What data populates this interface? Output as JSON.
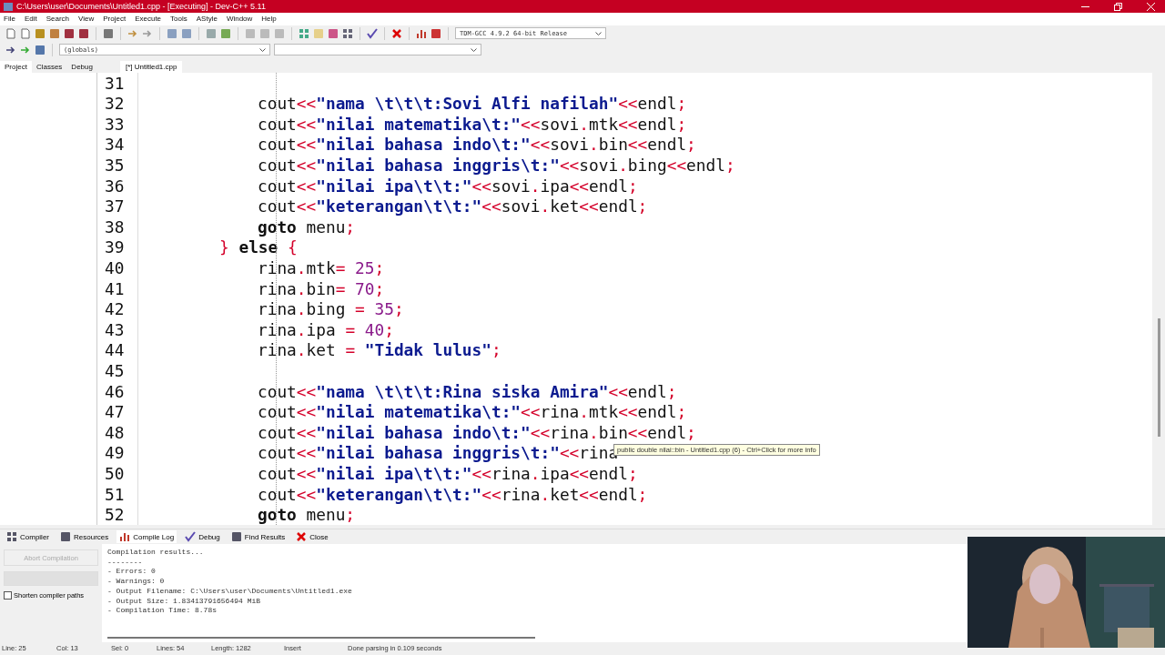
{
  "window": {
    "title": "C:\\Users\\user\\Documents\\Untitled1.cpp - [Executing] - Dev-C++ 5.11"
  },
  "menu": [
    "File",
    "Edit",
    "Search",
    "View",
    "Project",
    "Execute",
    "Tools",
    "AStyle",
    "Window",
    "Help"
  ],
  "toolbar": {
    "compiler_select": "TDM-GCC 4.9.2 64-bit Release",
    "scope_select": "(globals)"
  },
  "side_tabs": [
    {
      "label": "Project",
      "selected": true
    },
    {
      "label": "Classes",
      "selected": false
    },
    {
      "label": "Debug",
      "selected": false
    }
  ],
  "editor_tabs": [
    {
      "label": "[*] Untitled1.cpp",
      "selected": true
    }
  ],
  "code": [
    {
      "number": "31"
    },
    {
      "number": "32",
      "kind": "inner",
      "tokens": [
        {
          "kind": "id",
          "text": "cout"
        },
        {
          "kind": "op",
          "text": "<<"
        },
        {
          "kind": "str",
          "text": "\"nama \\t\\t\\t:Sovi Alfi nafilah\""
        },
        {
          "kind": "op",
          "text": "<<"
        },
        {
          "kind": "id",
          "text": "endl"
        },
        {
          "kind": "op",
          "text": ";"
        }
      ]
    },
    {
      "number": "33",
      "kind": "inner",
      "tokens": [
        {
          "kind": "id",
          "text": "cout"
        },
        {
          "kind": "op",
          "text": "<<"
        },
        {
          "kind": "str",
          "text": "\"nilai matematika\\t:\""
        },
        {
          "kind": "op",
          "text": "<<"
        },
        {
          "kind": "id",
          "text": "sovi"
        },
        {
          "kind": "op",
          "text": "."
        },
        {
          "kind": "id",
          "text": "mtk"
        },
        {
          "kind": "op",
          "text": "<<"
        },
        {
          "kind": "id",
          "text": "endl"
        },
        {
          "kind": "op",
          "text": ";"
        }
      ]
    },
    {
      "number": "34",
      "kind": "inner",
      "tokens": [
        {
          "kind": "id",
          "text": "cout"
        },
        {
          "kind": "op",
          "text": "<<"
        },
        {
          "kind": "str",
          "text": "\"nilai bahasa indo\\t:\""
        },
        {
          "kind": "op",
          "text": "<<"
        },
        {
          "kind": "id",
          "text": "sovi"
        },
        {
          "kind": "op",
          "text": "."
        },
        {
          "kind": "id",
          "text": "bin"
        },
        {
          "kind": "op",
          "text": "<<"
        },
        {
          "kind": "id",
          "text": "endl"
        },
        {
          "kind": "op",
          "text": ";"
        }
      ]
    },
    {
      "number": "35",
      "kind": "inner",
      "tokens": [
        {
          "kind": "id",
          "text": "cout"
        },
        {
          "kind": "op",
          "text": "<<"
        },
        {
          "kind": "str",
          "text": "\"nilai bahasa inggris\\t:\""
        },
        {
          "kind": "op",
          "text": "<<"
        },
        {
          "kind": "id",
          "text": "sovi"
        },
        {
          "kind": "op",
          "text": "."
        },
        {
          "kind": "id",
          "text": "bing"
        },
        {
          "kind": "op",
          "text": "<<"
        },
        {
          "kind": "id",
          "text": "endl"
        },
        {
          "kind": "op",
          "text": ";"
        }
      ]
    },
    {
      "number": "36",
      "kind": "inner",
      "tokens": [
        {
          "kind": "id",
          "text": "cout"
        },
        {
          "kind": "op",
          "text": "<<"
        },
        {
          "kind": "str",
          "text": "\"nilai ipa\\t\\t:\""
        },
        {
          "kind": "op",
          "text": "<<"
        },
        {
          "kind": "id",
          "text": "sovi"
        },
        {
          "kind": "op",
          "text": "."
        },
        {
          "kind": "id",
          "text": "ipa"
        },
        {
          "kind": "op",
          "text": "<<"
        },
        {
          "kind": "id",
          "text": "endl"
        },
        {
          "kind": "op",
          "text": ";"
        }
      ]
    },
    {
      "number": "37",
      "kind": "inner",
      "tokens": [
        {
          "kind": "id",
          "text": "cout"
        },
        {
          "kind": "op",
          "text": "<<"
        },
        {
          "kind": "str",
          "text": "\"keterangan\\t\\t:\""
        },
        {
          "kind": "op",
          "text": "<<"
        },
        {
          "kind": "id",
          "text": "sovi"
        },
        {
          "kind": "op",
          "text": "."
        },
        {
          "kind": "id",
          "text": "ket"
        },
        {
          "kind": "op",
          "text": "<<"
        },
        {
          "kind": "id",
          "text": "endl"
        },
        {
          "kind": "op",
          "text": ";"
        }
      ]
    },
    {
      "number": "38",
      "kind": "inner",
      "tokens": [
        {
          "kind": "kw",
          "text": "goto"
        },
        {
          "kind": "id",
          "text": " menu"
        },
        {
          "kind": "op",
          "text": ";"
        }
      ]
    },
    {
      "number": "39",
      "kind": "outer",
      "tokens": [
        {
          "kind": "op",
          "text": "}"
        },
        {
          "kind": "kw",
          "text": " else "
        },
        {
          "kind": "op",
          "text": "{"
        }
      ]
    },
    {
      "number": "40",
      "kind": "inner",
      "tokens": [
        {
          "kind": "id",
          "text": "rina"
        },
        {
          "kind": "op",
          "text": "."
        },
        {
          "kind": "id",
          "text": "mtk"
        },
        {
          "kind": "op",
          "text": "= "
        },
        {
          "kind": "num",
          "text": "25"
        },
        {
          "kind": "op",
          "text": ";"
        }
      ]
    },
    {
      "number": "41",
      "kind": "inner",
      "tokens": [
        {
          "kind": "id",
          "text": "rina"
        },
        {
          "kind": "op",
          "text": "."
        },
        {
          "kind": "id",
          "text": "bin"
        },
        {
          "kind": "op",
          "text": "= "
        },
        {
          "kind": "num",
          "text": "70"
        },
        {
          "kind": "op",
          "text": ";"
        }
      ]
    },
    {
      "number": "42",
      "kind": "inner",
      "tokens": [
        {
          "kind": "id",
          "text": "rina"
        },
        {
          "kind": "op",
          "text": "."
        },
        {
          "kind": "id",
          "text": "bing "
        },
        {
          "kind": "op",
          "text": "= "
        },
        {
          "kind": "num",
          "text": "35"
        },
        {
          "kind": "op",
          "text": ";"
        }
      ]
    },
    {
      "number": "43",
      "kind": "inner",
      "tokens": [
        {
          "kind": "id",
          "text": "rina"
        },
        {
          "kind": "op",
          "text": "."
        },
        {
          "kind": "id",
          "text": "ipa "
        },
        {
          "kind": "op",
          "text": "= "
        },
        {
          "kind": "num",
          "text": "40"
        },
        {
          "kind": "op",
          "text": ";"
        }
      ]
    },
    {
      "number": "44",
      "kind": "inner",
      "tokens": [
        {
          "kind": "id",
          "text": "rina"
        },
        {
          "kind": "op",
          "text": "."
        },
        {
          "kind": "id",
          "text": "ket "
        },
        {
          "kind": "op",
          "text": "= "
        },
        {
          "kind": "str",
          "text": "\"Tidak lulus\""
        },
        {
          "kind": "op",
          "text": ";"
        }
      ]
    },
    {
      "number": "45"
    },
    {
      "number": "46",
      "kind": "inner",
      "tokens": [
        {
          "kind": "id",
          "text": "cout"
        },
        {
          "kind": "op",
          "text": "<<"
        },
        {
          "kind": "str",
          "text": "\"nama \\t\\t\\t:Rina siska Amira\""
        },
        {
          "kind": "op",
          "text": "<<"
        },
        {
          "kind": "id",
          "text": "endl"
        },
        {
          "kind": "op",
          "text": ";"
        }
      ]
    },
    {
      "number": "47",
      "kind": "inner",
      "tokens": [
        {
          "kind": "id",
          "text": "cout"
        },
        {
          "kind": "op",
          "text": "<<"
        },
        {
          "kind": "str",
          "text": "\"nilai matematika\\t:\""
        },
        {
          "kind": "op",
          "text": "<<"
        },
        {
          "kind": "id",
          "text": "rina"
        },
        {
          "kind": "op",
          "text": "."
        },
        {
          "kind": "id",
          "text": "mtk"
        },
        {
          "kind": "op",
          "text": "<<"
        },
        {
          "kind": "id",
          "text": "endl"
        },
        {
          "kind": "op",
          "text": ";"
        }
      ]
    },
    {
      "number": "48",
      "kind": "inner",
      "tokens": [
        {
          "kind": "id",
          "text": "cout"
        },
        {
          "kind": "op",
          "text": "<<"
        },
        {
          "kind": "str",
          "text": "\"nilai bahasa indo\\t:\""
        },
        {
          "kind": "op",
          "text": "<<"
        },
        {
          "kind": "id",
          "text": "rina"
        },
        {
          "kind": "op",
          "text": "."
        },
        {
          "kind": "id",
          "text": "bin"
        },
        {
          "kind": "op",
          "text": "<<"
        },
        {
          "kind": "id",
          "text": "endl"
        },
        {
          "kind": "op",
          "text": ";"
        }
      ]
    },
    {
      "number": "49",
      "kind": "inner",
      "tokens": [
        {
          "kind": "id",
          "text": "cout"
        },
        {
          "kind": "op",
          "text": "<<"
        },
        {
          "kind": "str",
          "text": "\"nilai bahasa inggris\\t:\""
        },
        {
          "kind": "op",
          "text": "<<"
        },
        {
          "kind": "id",
          "text": "rina"
        }
      ]
    },
    {
      "number": "50",
      "kind": "inner",
      "tokens": [
        {
          "kind": "id",
          "text": "cout"
        },
        {
          "kind": "op",
          "text": "<<"
        },
        {
          "kind": "str",
          "text": "\"nilai ipa\\t\\t:\""
        },
        {
          "kind": "op",
          "text": "<<"
        },
        {
          "kind": "id",
          "text": "rina"
        },
        {
          "kind": "op",
          "text": "."
        },
        {
          "kind": "id",
          "text": "ipa"
        },
        {
          "kind": "op",
          "text": "<<"
        },
        {
          "kind": "id",
          "text": "endl"
        },
        {
          "kind": "op",
          "text": ";"
        }
      ]
    },
    {
      "number": "51",
      "kind": "inner",
      "tokens": [
        {
          "kind": "id",
          "text": "cout"
        },
        {
          "kind": "op",
          "text": "<<"
        },
        {
          "kind": "str",
          "text": "\"keterangan\\t\\t:\""
        },
        {
          "kind": "op",
          "text": "<<"
        },
        {
          "kind": "id",
          "text": "rina"
        },
        {
          "kind": "op",
          "text": "."
        },
        {
          "kind": "id",
          "text": "ket"
        },
        {
          "kind": "op",
          "text": "<<"
        },
        {
          "kind": "id",
          "text": "endl"
        },
        {
          "kind": "op",
          "text": ";"
        }
      ]
    },
    {
      "number": "52",
      "kind": "inner",
      "tokens": [
        {
          "kind": "kw",
          "text": "goto"
        },
        {
          "kind": "id",
          "text": " menu"
        },
        {
          "kind": "op",
          "text": ";"
        }
      ]
    }
  ],
  "tooltip": "public double nilai::bin - Untitled1.cpp (6) - Ctrl+Click for more info",
  "bottom_tabs": [
    {
      "label": "Compiler",
      "selected": false
    },
    {
      "label": "Resources",
      "selected": false
    },
    {
      "label": "Compile Log",
      "selected": true
    },
    {
      "label": "Debug",
      "selected": false
    },
    {
      "label": "Find Results",
      "selected": false
    },
    {
      "label": "Close",
      "selected": false
    }
  ],
  "abort_button": {
    "label": "Abort Compilation",
    "disabled": true
  },
  "shorten_paths": {
    "label": "Shorten compiler paths",
    "checked": false
  },
  "compile_log": [
    "Compilation results...",
    "--------",
    "- Errors: 0",
    "- Warnings: 0",
    "- Output Filename: C:\\Users\\user\\Documents\\Untitled1.exe",
    "- Output Size: 1.83413791656494 MiB",
    "- Compilation Time: 8.78s"
  ],
  "status_bar": [
    {
      "label": "Line:",
      "value": "25"
    },
    {
      "label": "Col:",
      "value": "13"
    },
    {
      "label": "Sel:",
      "value": "0"
    },
    {
      "label": "Lines:",
      "value": "54"
    },
    {
      "label": "Length:",
      "value": "1282"
    },
    {
      "value": "Insert"
    },
    {
      "value": "Done parsing in 0.109 seconds"
    }
  ]
}
